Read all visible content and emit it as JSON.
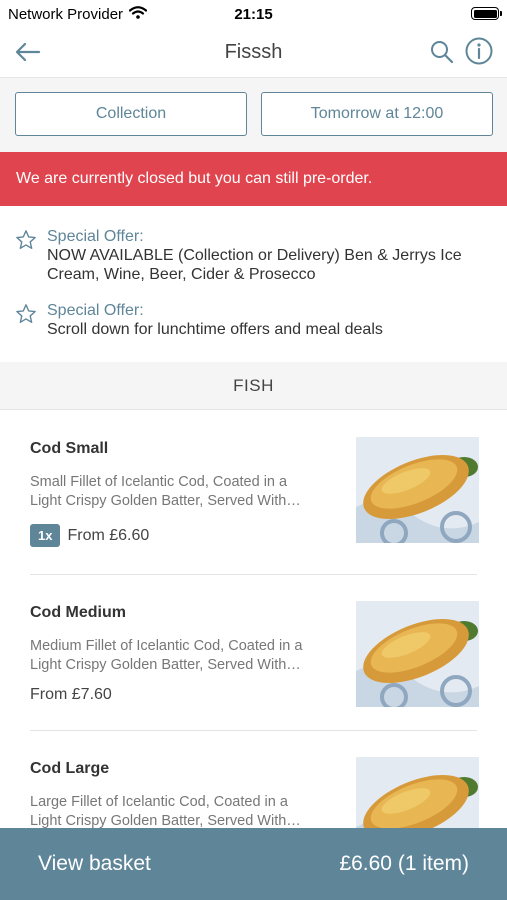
{
  "status_bar": {
    "carrier": "Network Provider",
    "time": "21:15"
  },
  "nav": {
    "title": "Fisssh"
  },
  "order_options": {
    "collection_label": "Collection",
    "time_label": "Tomorrow at 12:00"
  },
  "closed_banner": "We are currently closed but you can still pre-order.",
  "offers": [
    {
      "label": "Special Offer:",
      "text": "NOW AVAILABLE (Collection or Delivery) Ben & Jerrys Ice Cream, Wine, Beer, Cider & Prosecco"
    },
    {
      "label": "Special Offer:",
      "text": "Scroll down for lunchtime offers and meal deals"
    }
  ],
  "section": {
    "title": "FISH"
  },
  "items": [
    {
      "name": "Cod Small",
      "desc_line1": "Small Fillet of Icelantic Cod, Coated in a",
      "desc_line2": "Light Crispy Golden Batter, Served With…",
      "qty": "1x",
      "price": "From £6.60"
    },
    {
      "name": "Cod Medium",
      "desc_line1": "Medium Fillet of Icelantic Cod, Coated in a",
      "desc_line2": "Light Crispy Golden Batter, Served With…",
      "qty": "",
      "price": "From £7.60"
    },
    {
      "name": "Cod Large",
      "desc_line1": "Large Fillet of Icelantic Cod, Coated in a",
      "desc_line2": "Light Crispy Golden Batter, Served With…",
      "qty": "",
      "price": ""
    }
  ],
  "basket": {
    "label": "View basket",
    "total": "£6.60 (1 item)"
  },
  "colors": {
    "accent": "#5f8599",
    "closed_red": "#e0454f"
  },
  "icons": {
    "back": "arrow-left-icon",
    "search": "search-icon",
    "info": "info-icon",
    "star": "star-outline-icon",
    "wifi": "wifi-icon",
    "battery": "battery-icon"
  }
}
